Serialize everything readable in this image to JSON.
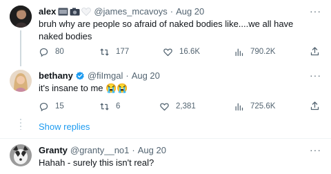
{
  "tweets": [
    {
      "name": "alex",
      "handle": "@james_mcavoys",
      "dot": "·",
      "time": "Aug 20",
      "text": "bruh why are people so afraid of naked bodies like....we all have naked bodies",
      "replies": "80",
      "retweets": "177",
      "likes": "16.6K",
      "views": "790.2K"
    },
    {
      "name": "bethany",
      "handle": "@fiImgal",
      "dot": "·",
      "time": "Aug 20",
      "text": "it's insane to me 😭😭",
      "replies": "15",
      "retweets": "6",
      "likes": "2,381",
      "views": "725.6K"
    },
    {
      "name": "Granty",
      "handle": "@granty__no1",
      "dot": "·",
      "time": "Aug 20",
      "text": "Hahah - surely this isn't real?"
    }
  ],
  "show_replies": "Show replies",
  "more_glyph": "···",
  "colors": {
    "link": "#1d9bf0",
    "muted": "#536471",
    "verified": "#1d9bf0"
  },
  "icons": [
    "reply-icon",
    "retweet-icon",
    "like-icon",
    "views-icon",
    "share-icon",
    "more-icon",
    "verified-icon"
  ]
}
